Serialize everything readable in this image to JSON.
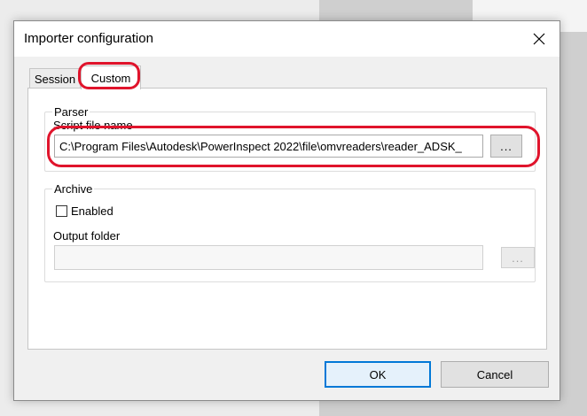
{
  "dialog": {
    "title": "Importer configuration",
    "close_icon": "close-icon"
  },
  "tabs": [
    {
      "label": "Session",
      "selected": false
    },
    {
      "label": "Custom",
      "selected": true
    }
  ],
  "parser": {
    "group_title": "Parser",
    "script_label": "Script file name",
    "script_value": "C:\\Program Files\\Autodesk\\PowerInspect 2022\\file\\omvreaders\\reader_ADSK_",
    "browse_label": "..."
  },
  "archive": {
    "group_title": "Archive",
    "enabled_label": "Enabled",
    "enabled_checked": false,
    "output_label": "Output folder",
    "output_value": "",
    "browse_label": "..."
  },
  "buttons": {
    "ok": "OK",
    "cancel": "Cancel"
  },
  "colors": {
    "annotation": "#e0142c",
    "default_button_border": "#0078d7"
  }
}
